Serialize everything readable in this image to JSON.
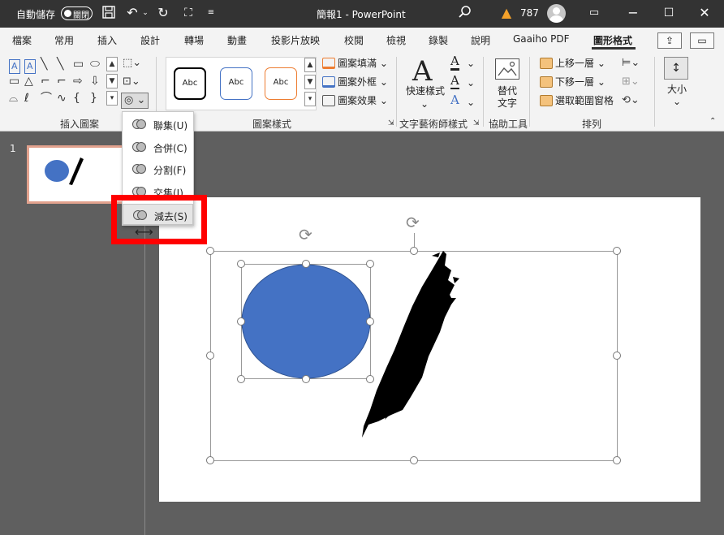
{
  "titlebar": {
    "autosave_label": "自動儲存",
    "autosave_state": "關閉",
    "doc_title": "簡報1 - PowerPoint",
    "warning_count": "787"
  },
  "tabs": [
    "檔案",
    "常用",
    "插入",
    "設計",
    "轉場",
    "動畫",
    "投影片放映",
    "校閱",
    "檢視",
    "錄製",
    "說明",
    "Gaaiho PDF",
    "圖形格式"
  ],
  "active_tab": "圖形格式",
  "groups": {
    "insert_shapes": "插入圖案",
    "shape_styles": "圖案樣式",
    "wordart_styles": "文字藝術師樣式",
    "accessibility": "協助工具",
    "arrange": "排列"
  },
  "shape_styles": {
    "preset_label": "Abc",
    "fill": "圖案填滿",
    "outline": "圖案外框",
    "effects": "圖案效果"
  },
  "wordart": {
    "quick_styles": "快速樣式"
  },
  "accessibility": {
    "alt_text_line1": "替代",
    "alt_text_line2": "文字"
  },
  "arrange": {
    "bring_forward": "上移一層",
    "send_backward": "下移一層",
    "selection_pane": "選取範圍窗格"
  },
  "size_label": "大小",
  "merge_menu": {
    "items": [
      "聯集(U)",
      "合併(C)",
      "分割(F)",
      "交集(I)",
      "減去(S)"
    ],
    "highlighted": "減去(S)"
  },
  "slides_pane": {
    "slide_number": "1"
  },
  "colors": {
    "titlebar": "#333333",
    "ribbon": "#f3f3f3",
    "workspace": "#5f5f5f",
    "shape_fill": "#4472c4",
    "highlight": "#ff0000"
  },
  "icons": {
    "save": "save-icon",
    "undo": "undo-icon",
    "redo": "redo-icon",
    "search": "search-icon",
    "warning": "warning-icon",
    "merge_shapes": "merge-shapes-icon"
  }
}
